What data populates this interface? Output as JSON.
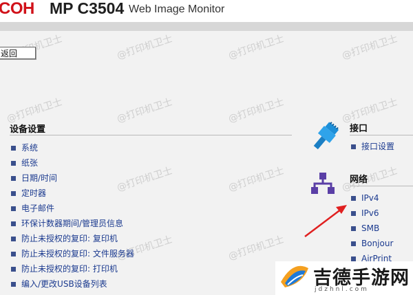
{
  "header": {
    "brand": "COH",
    "model": "MP C3504",
    "product_name": "Web Image Monitor"
  },
  "toolbar": {
    "back_label": "返回"
  },
  "left_section": {
    "title": "设备设置",
    "items": [
      "系统",
      "纸张",
      "日期/时间",
      "定时器",
      "电子邮件",
      "环保计数器期间/管理员信息",
      "防止未授权的复印: 复印机",
      "防止未授权的复印: 文件服务器",
      "防止未授权的复印: 打印机",
      "编入/更改USB设备列表"
    ]
  },
  "interface_section": {
    "title": "接口",
    "icon": "network-cable-icon",
    "items": [
      "接口设置"
    ]
  },
  "network_section": {
    "title": "网络",
    "icon": "network-topology-icon",
    "items": [
      "IPv4",
      "IPv6",
      "SMB",
      "Bonjour",
      "AirPrint"
    ]
  },
  "watermark": "@打印机卫士",
  "overlay_logo": {
    "text": "吉德手游网",
    "sub": "jdzhnl.com"
  },
  "colors": {
    "brand_red": "#d1121a",
    "link_blue": "#1b3a8f",
    "bullet": "#3a4f8c",
    "arrow": "#e02020"
  }
}
